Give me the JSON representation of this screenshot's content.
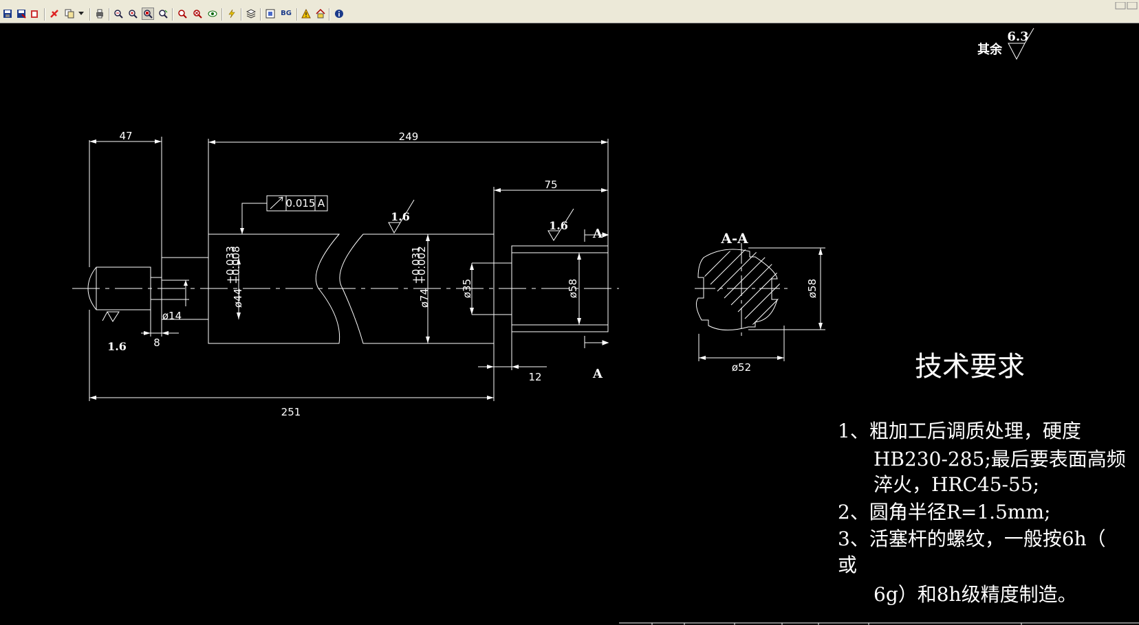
{
  "toolbar": {
    "buttons": [
      {
        "icon": "save-icon"
      },
      {
        "icon": "save-as-icon"
      },
      {
        "icon": "open-icon"
      },
      {
        "icon": "tools-icon"
      },
      {
        "icon": "copy-icon"
      },
      {
        "icon": "dropdown-icon"
      },
      {
        "icon": "print-icon"
      },
      {
        "icon": "zoom-out-icon"
      },
      {
        "icon": "zoom-in-icon"
      },
      {
        "icon": "zoom-window-icon"
      },
      {
        "icon": "zoom-pan-icon"
      },
      {
        "icon": "zoom-all-icon"
      },
      {
        "icon": "zoom-previous-icon"
      },
      {
        "icon": "eye-icon"
      },
      {
        "icon": "lightning-icon"
      },
      {
        "icon": "layers-icon"
      },
      {
        "icon": "frame-icon"
      },
      {
        "icon": "background-icon"
      },
      {
        "icon": "warning-icon"
      },
      {
        "icon": "home-icon"
      },
      {
        "icon": "info-icon"
      }
    ],
    "bg_label": "BG"
  },
  "drawing": {
    "surface_roughness_general": {
      "prefix": "其余",
      "value": "6.3"
    },
    "dims": {
      "d47": "47",
      "d249": "249",
      "d75": "75",
      "d12": "12",
      "d251": "251",
      "d8": "8",
      "phi14": "ø14",
      "phi44": "ø44",
      "tol44_upper": "+0.033",
      "tol44_lower": "+0.008",
      "phi74": "ø74",
      "tol74_upper": "+0.031",
      "tol74_lower": "+0.002",
      "phi35": "ø35",
      "phi58": "ø58",
      "phi58_section": "ø58",
      "phi52": "ø52"
    },
    "roughness": {
      "left": "1.6",
      "middle": "1.6",
      "right": "1.6"
    },
    "tolerance_frame": {
      "value": "0.015",
      "datum": "A"
    },
    "section_marker": "A",
    "section_title": "A-A"
  },
  "tech": {
    "title": "技术要求",
    "lines": [
      "1、粗加工后调质处理，硬度",
      "HB230-285;最后要表面高频",
      "淬火，HRC45-55;",
      "2、圆角半径R=1.5mm;",
      "3、活塞杆的螺纹，一般按6h（",
      "或",
      "6g）和8h级精度制造。"
    ]
  },
  "colors": {
    "background": "#000000",
    "lines": "#ffffff",
    "toolbar": "#ece9d8"
  }
}
